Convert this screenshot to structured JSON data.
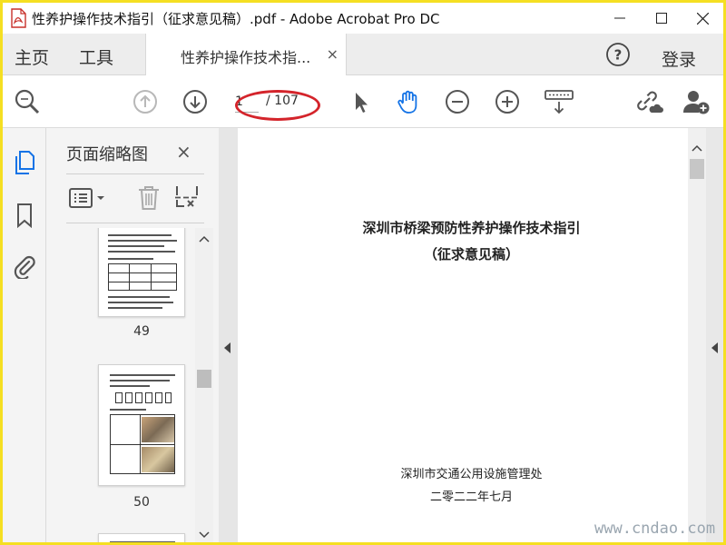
{
  "window": {
    "title": "性养护操作技术指引（征求意见稿）.pdf - Adobe Acrobat Pro DC",
    "controls": [
      "minimize-icon",
      "maximize-icon",
      "close-icon"
    ]
  },
  "tabs": {
    "home": "主页",
    "tools": "工具",
    "document_tab": "性养护操作技术指...",
    "document_tab_close": "×",
    "help": "?",
    "login": "登录"
  },
  "toolbar": {
    "icons": [
      "zoom-search-icon",
      "page-up-icon",
      "page-down-icon",
      "select-pointer-icon",
      "hand-tool-icon",
      "zoom-out-icon",
      "zoom-in-icon",
      "keyboard-scroll-icon",
      "share-link-icon",
      "add-user-icon"
    ],
    "page_current": "1",
    "page_total": "/ 107",
    "highlight_color": "#d4242b",
    "active_tool_color": "#1473e6"
  },
  "rail": {
    "icons": [
      "page-thumbnails-icon",
      "bookmarks-icon",
      "attachments-icon"
    ]
  },
  "thumbnail_panel": {
    "title": "页面缩略图",
    "close": "×",
    "tools": [
      "thumbnail-options-icon",
      "delete-page-icon",
      "crop-page-icon"
    ],
    "thumbs": [
      {
        "page": "49"
      },
      {
        "page": "50"
      }
    ]
  },
  "document": {
    "title": "深圳市桥梁预防性养护操作技术指引",
    "subtitle": "（征求意见稿）",
    "issuer": "深圳市交通公用设施管理处",
    "date": "二零二二年七月"
  },
  "watermark": "www.cndao.com",
  "colors": {
    "frame": "#f5df22",
    "tab_bar": "#ededed",
    "panel": "#f4f4f4"
  }
}
